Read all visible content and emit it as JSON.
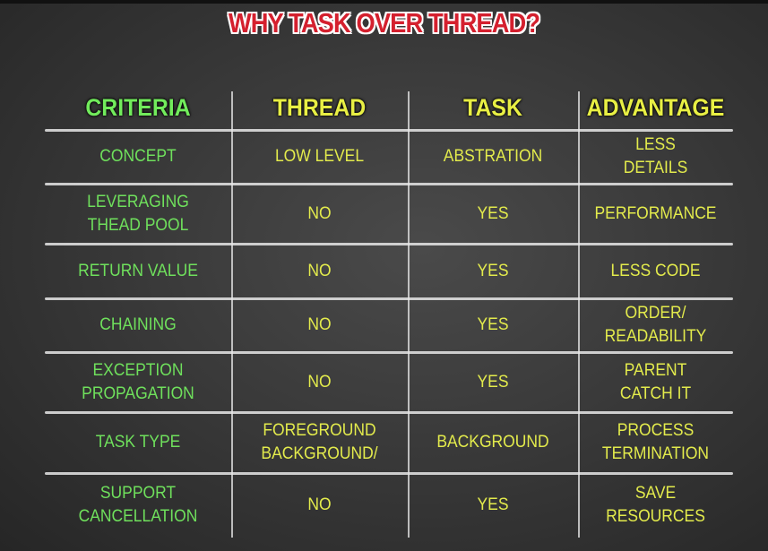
{
  "title": "WHY TASK OVER THREAD?",
  "headers": [
    "CRITERIA",
    "THREAD",
    "TASK",
    "ADVANTAGE"
  ],
  "rows": [
    [
      "CONCEPT",
      "LOW LEVEL",
      "ABSTRATION",
      "LESS\nDETAILS"
    ],
    [
      "LEVERAGING\nTHEAD POOL",
      "NO",
      "YES",
      "PERFORMANCE"
    ],
    [
      "RETURN VALUE",
      "NO",
      "YES",
      "LESS CODE"
    ],
    [
      "CHAINING",
      "NO",
      "YES",
      "ORDER/\nREADABILITY"
    ],
    [
      "EXCEPTION\nPROPAGATION",
      "NO",
      "YES",
      "PARENT\nCATCH IT"
    ],
    [
      "TASK TYPE",
      "FOREGROUND\nBACKGROUND/",
      "BACKGROUND",
      "PROCESS\nTERMINATION"
    ],
    [
      "SUPPORT\nCANCELLATION",
      "NO",
      "YES",
      "SAVE\nRESOURCES"
    ]
  ],
  "colors": {
    "criteria": "#6fe05c",
    "values": "#e3eb4c",
    "title": "#d4202e"
  }
}
